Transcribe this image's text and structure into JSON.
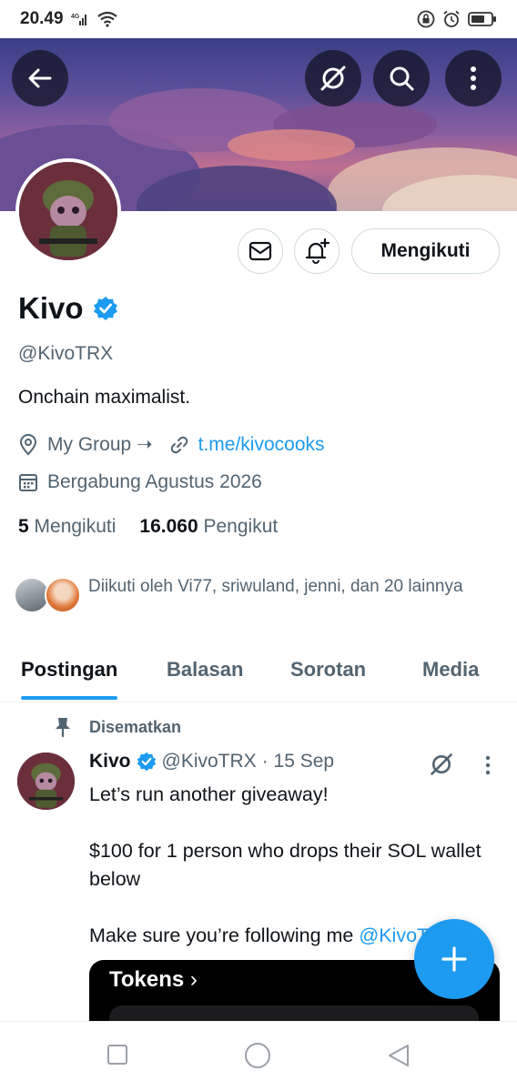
{
  "status_bar": {
    "time": "20.49",
    "network": "4G"
  },
  "profile": {
    "name": "Kivo",
    "handle": "@KivoTRX",
    "bio": "Onchain maximalist.",
    "location": "My Group ➝",
    "website": "t.me/kivocooks",
    "joined": "Bergabung Agustus 2026",
    "following_count": "5",
    "following_label": "Mengikuti",
    "followers_count": "16.060",
    "followers_label": "Pengikut",
    "followed_by": "Diikuti oleh Vi77, sriwuland, jenni, dan 20 lainnya",
    "follow_button": "Mengikuti"
  },
  "tabs": [
    "Postingan",
    "Balasan",
    "Sorotan",
    "Media"
  ],
  "pinned_tweet": {
    "pinned_label": "Disematkan",
    "author_name": "Kivo",
    "author_handle": "@KivoTRX",
    "date": "· 15 Sep",
    "line1": "Let’s run another giveaway!",
    "line2": "$100 for 1 person who drops their SOL wallet below",
    "line3": "Make sure you’re following me",
    "mention": "@KivoTRX",
    "media_title": "Tokens"
  },
  "colors": {
    "accent": "#1d9bf0",
    "text": "#0f1419",
    "muted": "#536471"
  },
  "icons": [
    "back-arrow-icon",
    "grok-icon",
    "search-icon",
    "more-vertical-icon",
    "mail-icon",
    "bell-plus-icon",
    "verified-badge-icon",
    "location-pin-icon",
    "link-icon",
    "calendar-icon",
    "pin-icon",
    "compose-plus-icon"
  ]
}
